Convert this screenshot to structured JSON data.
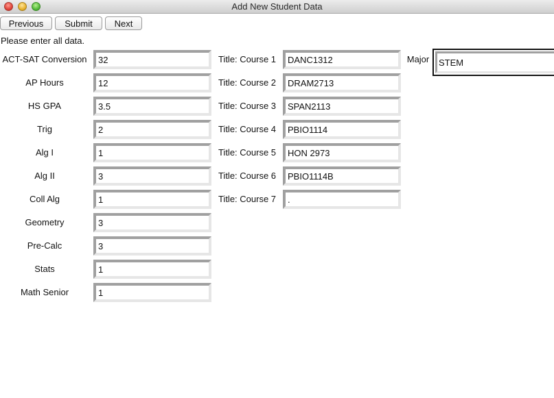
{
  "window": {
    "title": "Add New Student Data"
  },
  "toolbar": {
    "previous_label": "Previous",
    "submit_label": "Submit",
    "next_label": "Next"
  },
  "instructions": "Please enter all data.",
  "left_fields": [
    {
      "label": "ACT-SAT Conversion",
      "value": "32"
    },
    {
      "label": "AP Hours",
      "value": "12"
    },
    {
      "label": "HS GPA",
      "value": "3.5"
    },
    {
      "label": "Trig",
      "value": "2"
    },
    {
      "label": "Alg I",
      "value": "1"
    },
    {
      "label": "Alg II",
      "value": "3"
    },
    {
      "label": "Coll Alg",
      "value": "1"
    },
    {
      "label": "Geometry",
      "value": "3"
    },
    {
      "label": "Pre-Calc",
      "value": "3"
    },
    {
      "label": "Stats",
      "value": "1"
    },
    {
      "label": "Math Senior",
      "value": "1"
    }
  ],
  "course_fields": [
    {
      "label": "Title: Course 1",
      "value": "DANC1312"
    },
    {
      "label": "Title: Course 2",
      "value": "DRAM2713"
    },
    {
      "label": "Title: Course 3",
      "value": "SPAN2113"
    },
    {
      "label": "Title: Course 4",
      "value": "PBIO1114"
    },
    {
      "label": "Title: Course 5",
      "value": "HON 2973"
    },
    {
      "label": "Title: Course 6",
      "value": "PBIO1114B"
    },
    {
      "label": "Title: Course 7",
      "value": "."
    }
  ],
  "major": {
    "label": "Major",
    "value": "STEM"
  },
  "colors": {
    "focus_border": "#111111",
    "field_shadow": "#a0a0a0",
    "field_highlight": "#e6e6e6"
  }
}
